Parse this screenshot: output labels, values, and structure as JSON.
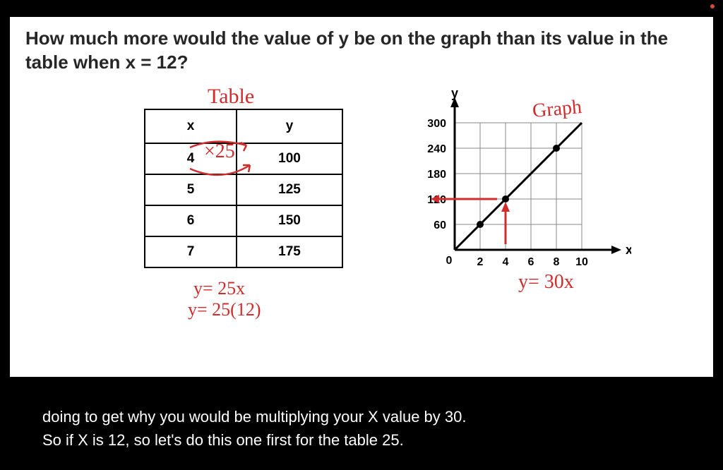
{
  "question": "How much more would the value of y be on the graph than its value in the table when x = 12?",
  "table": {
    "label": "Table",
    "headers": {
      "x": "x",
      "y": "y"
    },
    "rows": [
      {
        "x": 4,
        "y": 100
      },
      {
        "x": 5,
        "y": 125
      },
      {
        "x": 6,
        "y": 150
      },
      {
        "x": 7,
        "y": 175
      }
    ],
    "annotation_rate": "×25",
    "equation1": "y= 25x",
    "equation2": "y= 25(12)"
  },
  "graph": {
    "label": "Graph",
    "equation": "y= 30x",
    "y_axis_label": "y",
    "x_axis_label": "x"
  },
  "chart_data": {
    "type": "line",
    "title": "",
    "xlabel": "x",
    "ylabel": "y",
    "x_ticks": [
      0,
      2,
      4,
      6,
      8,
      10
    ],
    "y_ticks": [
      0,
      60,
      120,
      180,
      240,
      300
    ],
    "xlim": [
      0,
      10
    ],
    "ylim": [
      0,
      300
    ],
    "series": [
      {
        "name": "line",
        "x": [
          0,
          2,
          4,
          8
        ],
        "y": [
          0,
          60,
          120,
          240
        ]
      }
    ],
    "annotations": {
      "arrows_to": [
        {
          "x": 4,
          "y": 120
        }
      ],
      "equation": "y= 30x"
    }
  },
  "caption": {
    "line1": "doing to get why you would be multiplying your X value by 30.",
    "line2": "So if X is 12, so let's do this one first for the table 25."
  }
}
